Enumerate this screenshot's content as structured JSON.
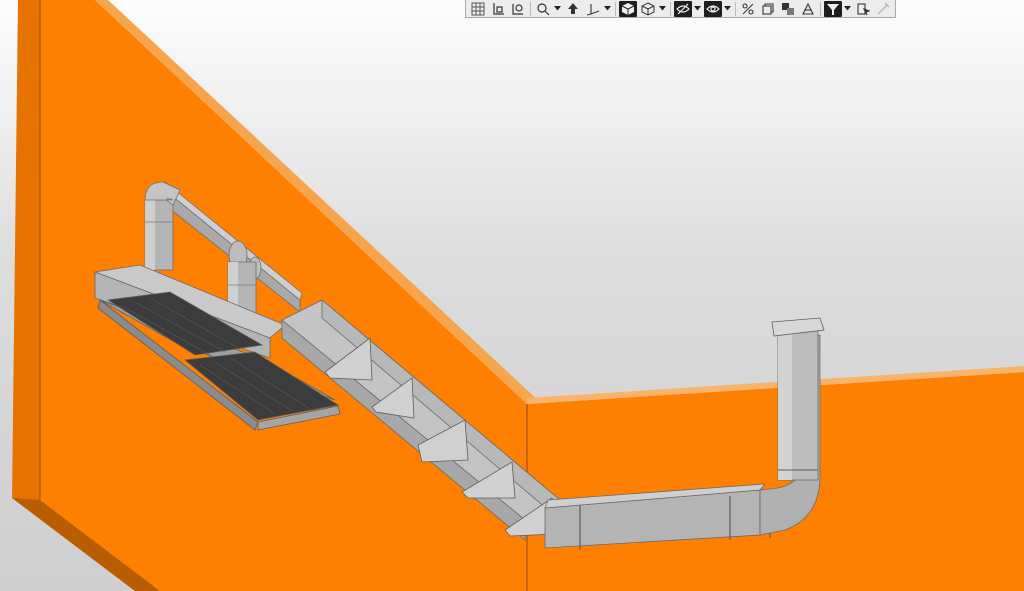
{
  "app": {
    "view_type": "3d-model-viewport"
  },
  "colors": {
    "wall": "#ff8000",
    "wall_shade": "#d96e00",
    "wall_edge": "#8a4a00",
    "duct": "#b3b3b3",
    "duct_light": "#cdcdcd",
    "duct_dark": "#8e8e8e",
    "grille": "#3c3c3c",
    "toolbar_bg": "#ececec",
    "toolbar_active": "#1e1e1e"
  },
  "toolbar": {
    "buttons": [
      {
        "name": "grid-icon",
        "active": false
      },
      {
        "name": "local-cs-icon",
        "active": false
      },
      {
        "name": "view-orient-icon",
        "active": false
      },
      {
        "name": "zoom-icon",
        "active": false,
        "dropdown": true
      },
      {
        "name": "pan-rotate-icon",
        "active": false
      },
      {
        "name": "axes-icon",
        "active": false,
        "dropdown": true
      },
      {
        "name": "shaded-cube-icon",
        "active": true
      },
      {
        "name": "wireframe-cube-icon",
        "active": false,
        "dropdown": true
      },
      {
        "name": "hide-eye-icon",
        "active": true,
        "dropdown": true
      },
      {
        "name": "show-eye-icon",
        "active": true,
        "dropdown": true
      },
      {
        "name": "snap-icon",
        "active": false
      },
      {
        "name": "section-icon",
        "active": false
      },
      {
        "name": "layers-icon",
        "active": false
      },
      {
        "name": "display-icon",
        "active": false
      },
      {
        "name": "filter-icon",
        "active": true,
        "dropdown": true
      },
      {
        "name": "select-filter-icon",
        "active": false
      },
      {
        "name": "pencil-icon",
        "active": false
      }
    ]
  }
}
